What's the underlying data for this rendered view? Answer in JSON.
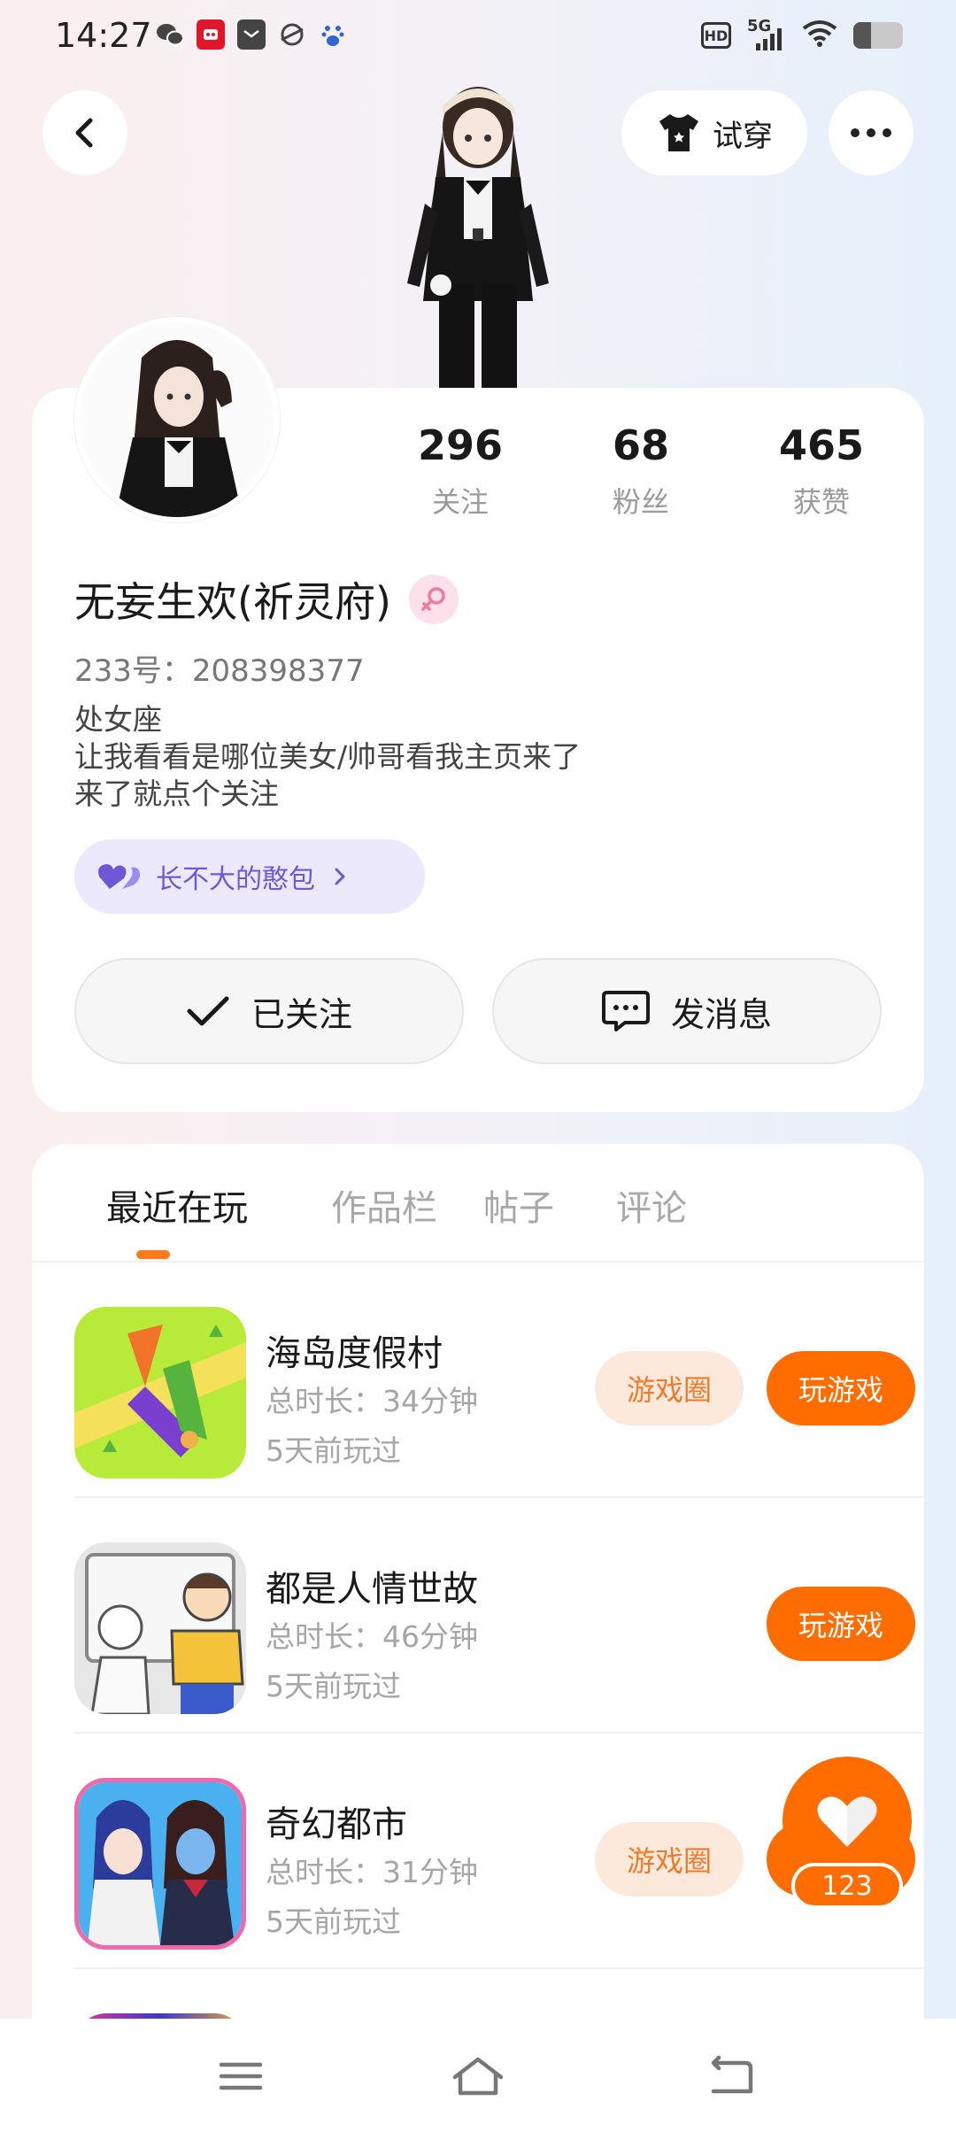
{
  "status": {
    "time": "14:27",
    "hd": "HD",
    "network": "5G",
    "battery_level": 0.35,
    "apps": [
      "wechat-icon",
      "tmall-icon",
      "mail-icon",
      "planet-icon",
      "baidu-icon"
    ]
  },
  "header": {
    "tryon_label": "试穿"
  },
  "profile": {
    "stats": [
      {
        "value": "296",
        "label": "关注"
      },
      {
        "value": "68",
        "label": "粉丝"
      },
      {
        "value": "465",
        "label": "获赞"
      }
    ],
    "username": "无妄生欢(祈灵府)",
    "uid": "233号：208398377",
    "bio": [
      "处女座",
      "让我看看是哪位美女/帅哥看我主页来了",
      "来了就点个关注"
    ],
    "family_label": "长不大的憨包",
    "follow_label": "已关注",
    "message_label": "发消息"
  },
  "tabs": [
    "最近在玩",
    "作品栏",
    "帖子",
    "评论"
  ],
  "games": [
    {
      "name": "海岛度假村",
      "duration": "总时长：34分钟",
      "last_played": "5天前玩过",
      "circle_label": "游戏圈",
      "play_label": "玩游戏"
    },
    {
      "name": "都是人情世故",
      "duration": "总时长：46分钟",
      "last_played": "5天前玩过",
      "circle_label": "",
      "play_label": "玩游戏"
    },
    {
      "name": "奇幻都市",
      "duration": "总时长：31分钟",
      "last_played": "5天前玩过",
      "circle_label": "游戏圈",
      "play_label": "玩游戏"
    }
  ],
  "like_count": "123",
  "colors": {
    "accent": "#ff6d00",
    "accent_light": "#fde9dc",
    "family_chip": "#ece9fd",
    "family_text": "#6f58d6",
    "gender_badge": "#fde0ea"
  }
}
